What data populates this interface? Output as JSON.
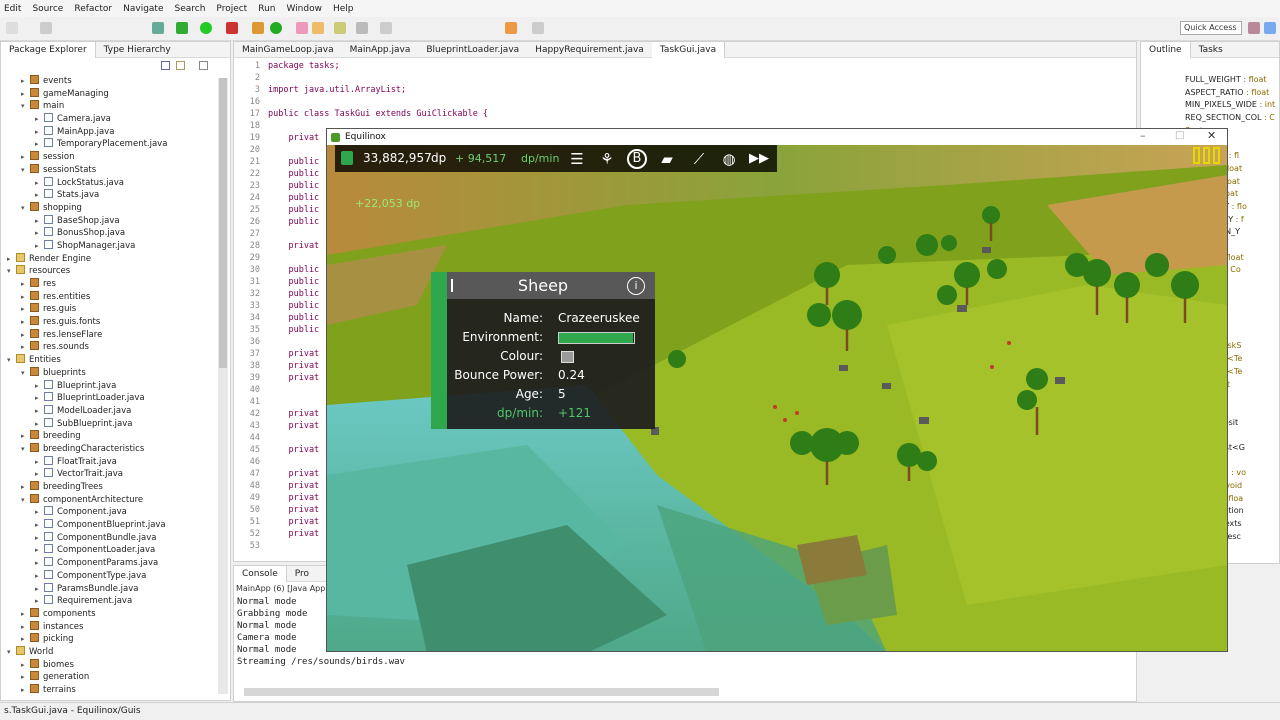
{
  "menu": [
    "Edit",
    "Source",
    "Refactor",
    "Navigate",
    "Search",
    "Project",
    "Run",
    "Window",
    "Help"
  ],
  "quick_access": "Quick Access",
  "package_explorer": {
    "tabs": [
      "Package Explorer",
      "Type Hierarchy"
    ],
    "tree": [
      {
        "l": "events",
        "d": 1,
        "t": "pkg",
        "tw": "▸"
      },
      {
        "l": "gameManaging",
        "d": 1,
        "t": "pkg",
        "tw": "▸"
      },
      {
        "l": "main",
        "d": 1,
        "t": "pkg",
        "tw": "▾"
      },
      {
        "l": "Camera.java",
        "d": 2,
        "t": "jv",
        "tw": "▸"
      },
      {
        "l": "MainApp.java",
        "d": 2,
        "t": "jv",
        "tw": "▸"
      },
      {
        "l": "TemporaryPlacement.java",
        "d": 2,
        "t": "jv",
        "tw": "▸"
      },
      {
        "l": "session",
        "d": 1,
        "t": "pkg",
        "tw": "▸"
      },
      {
        "l": "sessionStats",
        "d": 1,
        "t": "pkg",
        "tw": "▾"
      },
      {
        "l": "LockStatus.java",
        "d": 2,
        "t": "jv",
        "tw": "▸"
      },
      {
        "l": "Stats.java",
        "d": 2,
        "t": "jv",
        "tw": "▸"
      },
      {
        "l": "shopping",
        "d": 1,
        "t": "pkg",
        "tw": "▾"
      },
      {
        "l": "BaseShop.java",
        "d": 2,
        "t": "jv",
        "tw": "▸"
      },
      {
        "l": "BonusShop.java",
        "d": 2,
        "t": "jv",
        "tw": "▸"
      },
      {
        "l": "ShopManager.java",
        "d": 2,
        "t": "jv",
        "tw": "▸"
      },
      {
        "l": "Render Engine",
        "d": 0,
        "t": "fold",
        "tw": "▸"
      },
      {
        "l": "resources",
        "d": 0,
        "t": "fold",
        "tw": "▾"
      },
      {
        "l": "res",
        "d": 1,
        "t": "pkg",
        "tw": "▸"
      },
      {
        "l": "res.entities",
        "d": 1,
        "t": "pkg",
        "tw": "▸"
      },
      {
        "l": "res.guis",
        "d": 1,
        "t": "pkg",
        "tw": "▸"
      },
      {
        "l": "res.guis.fonts",
        "d": 1,
        "t": "pkg",
        "tw": "▸"
      },
      {
        "l": "res.lenseFlare",
        "d": 1,
        "t": "pkg",
        "tw": "▸"
      },
      {
        "l": "res.sounds",
        "d": 1,
        "t": "pkg",
        "tw": "▸"
      },
      {
        "l": "Entities",
        "d": 0,
        "t": "fold",
        "tw": "▾"
      },
      {
        "l": "blueprints",
        "d": 1,
        "t": "pkg",
        "tw": "▾"
      },
      {
        "l": "Blueprint.java",
        "d": 2,
        "t": "jv",
        "tw": "▸"
      },
      {
        "l": "BlueprintLoader.java",
        "d": 2,
        "t": "jv",
        "tw": "▸"
      },
      {
        "l": "ModelLoader.java",
        "d": 2,
        "t": "jv",
        "tw": "▸"
      },
      {
        "l": "SubBlueprint.java",
        "d": 2,
        "t": "jv",
        "tw": "▸"
      },
      {
        "l": "breeding",
        "d": 1,
        "t": "pkg",
        "tw": "▸"
      },
      {
        "l": "breedingCharacteristics",
        "d": 1,
        "t": "pkg",
        "tw": "▾"
      },
      {
        "l": "FloatTrait.java",
        "d": 2,
        "t": "jv",
        "tw": "▸"
      },
      {
        "l": "VectorTrait.java",
        "d": 2,
        "t": "jv",
        "tw": "▸"
      },
      {
        "l": "breedingTrees",
        "d": 1,
        "t": "pkg",
        "tw": "▸"
      },
      {
        "l": "componentArchitecture",
        "d": 1,
        "t": "pkg",
        "tw": "▾"
      },
      {
        "l": "Component.java",
        "d": 2,
        "t": "jv",
        "tw": "▸"
      },
      {
        "l": "ComponentBlueprint.java",
        "d": 2,
        "t": "jv",
        "tw": "▸"
      },
      {
        "l": "ComponentBundle.java",
        "d": 2,
        "t": "jv",
        "tw": "▸"
      },
      {
        "l": "ComponentLoader.java",
        "d": 2,
        "t": "jv",
        "tw": "▸"
      },
      {
        "l": "ComponentParams.java",
        "d": 2,
        "t": "jv",
        "tw": "▸"
      },
      {
        "l": "ComponentType.java",
        "d": 2,
        "t": "jv",
        "tw": "▸"
      },
      {
        "l": "ParamsBundle.java",
        "d": 2,
        "t": "jv",
        "tw": "▸"
      },
      {
        "l": "Requirement.java",
        "d": 2,
        "t": "jv",
        "tw": "▸"
      },
      {
        "l": "components",
        "d": 1,
        "t": "pkg",
        "tw": "▸"
      },
      {
        "l": "instances",
        "d": 1,
        "t": "pkg",
        "tw": "▸"
      },
      {
        "l": "picking",
        "d": 1,
        "t": "pkg",
        "tw": "▸"
      },
      {
        "l": "World",
        "d": 0,
        "t": "fold",
        "tw": "▾"
      },
      {
        "l": "biomes",
        "d": 1,
        "t": "pkg",
        "tw": "▸"
      },
      {
        "l": "generation",
        "d": 1,
        "t": "pkg",
        "tw": "▸"
      },
      {
        "l": "terrains",
        "d": 1,
        "t": "pkg",
        "tw": "▸"
      }
    ]
  },
  "editor": {
    "tabs": [
      "MainGameLoop.java",
      "MainApp.java",
      "BlueprintLoader.java",
      "HappyRequirement.java",
      "TaskGui.java"
    ],
    "lines": [
      {
        "n": "1",
        "c": "package tasks;"
      },
      {
        "n": "2",
        "c": ""
      },
      {
        "n": "3",
        "c": "import java.util.ArrayList;"
      },
      {
        "n": "16",
        "c": ""
      },
      {
        "n": "17",
        "c": "public class TaskGui extends GuiClickable {"
      },
      {
        "n": "18",
        "c": ""
      },
      {
        "n": "19",
        "c": "    privat"
      },
      {
        "n": "20",
        "c": ""
      },
      {
        "n": "21",
        "c": "    public"
      },
      {
        "n": "22",
        "c": "    public"
      },
      {
        "n": "23",
        "c": "    public"
      },
      {
        "n": "24",
        "c": "    public"
      },
      {
        "n": "25",
        "c": "    public"
      },
      {
        "n": "26",
        "c": "    public"
      },
      {
        "n": "27",
        "c": ""
      },
      {
        "n": "28",
        "c": "    privat"
      },
      {
        "n": "29",
        "c": ""
      },
      {
        "n": "30",
        "c": "    public"
      },
      {
        "n": "31",
        "c": "    public"
      },
      {
        "n": "32",
        "c": "    public"
      },
      {
        "n": "33",
        "c": "    public"
      },
      {
        "n": "34",
        "c": "    public"
      },
      {
        "n": "35",
        "c": "    public"
      },
      {
        "n": "36",
        "c": ""
      },
      {
        "n": "37",
        "c": "    privat"
      },
      {
        "n": "38",
        "c": "    privat"
      },
      {
        "n": "39",
        "c": "    privat"
      },
      {
        "n": "40",
        "c": ""
      },
      {
        "n": "41",
        "c": ""
      },
      {
        "n": "42",
        "c": "    privat"
      },
      {
        "n": "43",
        "c": "    privat"
      },
      {
        "n": "44",
        "c": ""
      },
      {
        "n": "45",
        "c": "    privat"
      },
      {
        "n": "46",
        "c": ""
      },
      {
        "n": "47",
        "c": "    privat"
      },
      {
        "n": "48",
        "c": "    privat"
      },
      {
        "n": "49",
        "c": "    privat"
      },
      {
        "n": "50",
        "c": "    privat"
      },
      {
        "n": "51",
        "c": "    privat"
      },
      {
        "n": "52",
        "c": "    privat"
      },
      {
        "n": "53",
        "c": ""
      }
    ]
  },
  "console": {
    "tabs": [
      "Console",
      "Pro"
    ],
    "header": "MainApp (6) [Java Applic",
    "lines": [
      "Normal mode",
      "Grabbing mode",
      "Normal mode",
      "Camera mode",
      "Normal mode",
      "Streaming /res/sounds/birds.wav"
    ]
  },
  "outline": {
    "tabs": [
      "Outline",
      "Tasks"
    ],
    "items": [
      {
        "n": "FULL_WEIGHT",
        "t": " : float"
      },
      {
        "n": "ASPECT_RATIO",
        "t": " : float"
      },
      {
        "n": "MIN_PIXELS_WIDE",
        "t": " : int"
      },
      {
        "n": "REQ_SECTION_COL",
        "t": " : C"
      },
      {
        "n": "",
        "t": "float"
      },
      {
        "n": "D",
        "t": " : float"
      },
      {
        "n": "RT_WIDTH",
        "t": " : fl"
      },
      {
        "n": "_WIDTH",
        "t": " : float"
      },
      {
        "n": "PART_X",
        "t": " : float"
      },
      {
        "n": "WIDTH",
        "t": " : float"
      },
      {
        "n": "SECTION_Y",
        "t": " : flo"
      },
      {
        "n": "_SECTION_Y",
        "t": " : f"
      },
      {
        "n": "M_SECTION_Y",
        "t": ""
      },
      {
        "n": "IZE",
        "t": " : float"
      },
      {
        "n": "NT_SIZE",
        "t": " : float"
      },
      {
        "n": "OMPLETE",
        "t": " : Co"
      },
      {
        "n": "",
        "t": "k"
      },
      {
        "n": "",
        "t": "Texture"
      },
      {
        "n": "",
        "t": " GuiTexture"
      },
      {
        "n": "",
        "t": " GuiTexture"
      },
      {
        "n": "",
        "t": "uiTexture"
      },
      {
        "n": "dState",
        "t": " : TaskS"
      },
      {
        "n": "Texts",
        "t": " : List<Te"
      },
      {
        "n": "Texts",
        "t": " : List<Te"
      },
      {
        "n": "eText",
        "t": " : Text"
      },
      {
        "n": "Task)",
        "t": ""
      },
      {
        "n": "",
        "t": "oid"
      },
      {
        "n": "eTexturePosit",
        "t": ""
      },
      {
        "n": "elf()",
        "t": " : void"
      },
      {
        "n": "extures(List<G",
        "t": ""
      },
      {
        "n": "res()",
        "t": " : void"
      },
      {
        "n": "StateText()",
        "t": " : vo"
      },
      {
        "n": "heText()",
        "t": " : void"
      },
      {
        "n": "ardText()",
        "t": " : floa"
      },
      {
        "n": "ardDescription",
        "t": ""
      },
      {
        "n": "uirementTexts",
        "t": ""
      },
      {
        "n": "uirementDesc",
        "t": ""
      }
    ]
  },
  "game": {
    "window_title": "Equilinox",
    "points": "33,882,957",
    "points_unit": "dp",
    "rate": "+ 94,517",
    "rate_unit": "dp/min",
    "gain_popup": "+22,053 dp",
    "info_panel": {
      "title": "Sheep",
      "rows": [
        {
          "label": "Name:",
          "value": "Crazeeruskee"
        },
        {
          "label": "Environment:",
          "value": ""
        },
        {
          "label": "Colour:",
          "value": ""
        },
        {
          "label": "Bounce Power:",
          "value": "0.24"
        },
        {
          "label": "Age:",
          "value": "5"
        },
        {
          "label": "dp/min:",
          "value": "+121"
        }
      ],
      "environment_level": 0.98
    }
  },
  "status_bar": "s.TaskGui.java - Equilinox/Guis",
  "colors": {
    "accent": "#2fa84d",
    "hud": "#1a1a1a",
    "keyword": "#7f0055"
  }
}
